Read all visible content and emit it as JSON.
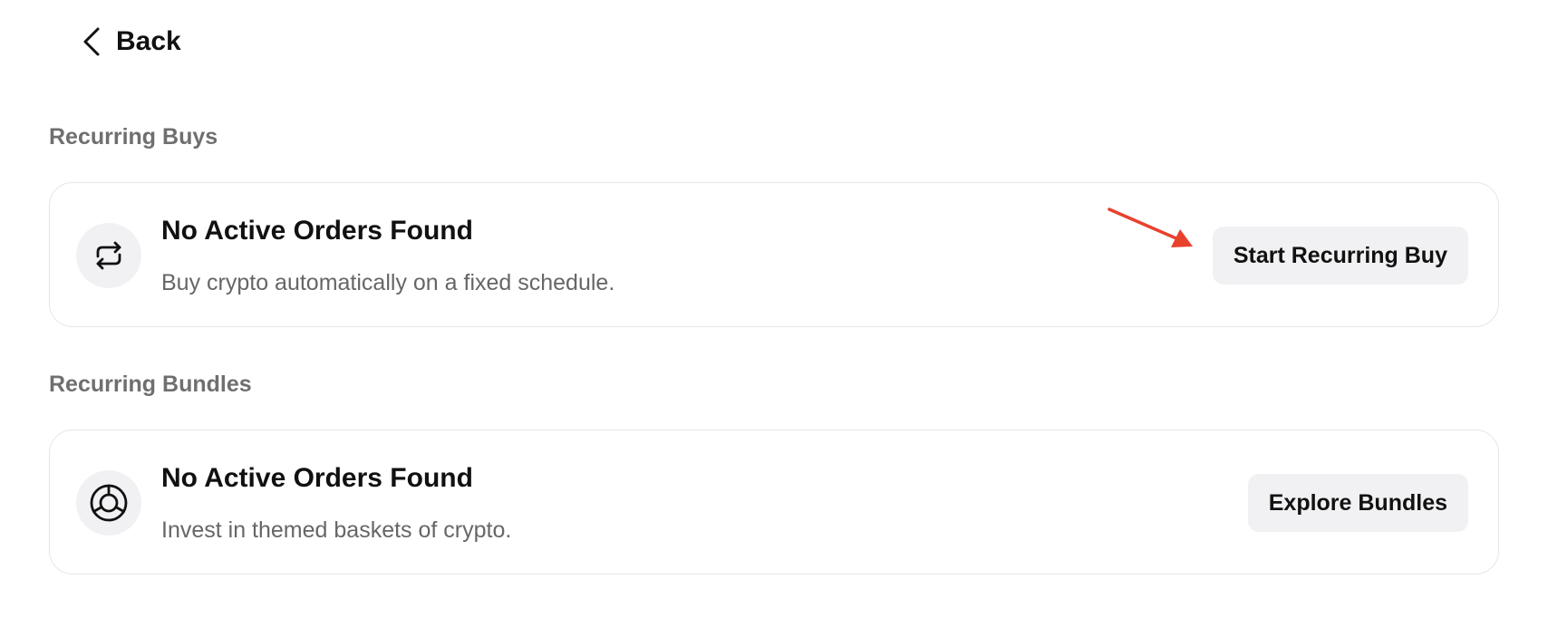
{
  "nav": {
    "back_label": "Back"
  },
  "sections": [
    {
      "title": "Recurring Buys",
      "card": {
        "icon": "recurring-arrows-icon",
        "title": "No Active Orders Found",
        "description": "Buy crypto automatically on a fixed schedule.",
        "button_label": "Start Recurring Buy"
      }
    },
    {
      "title": "Recurring Bundles",
      "card": {
        "icon": "bundle-circle-icon",
        "title": "No Active Orders Found",
        "description": "Invest in themed baskets of crypto.",
        "button_label": "Explore Bundles"
      }
    }
  ],
  "annotation": {
    "icon": "red-arrow-icon",
    "color": "#e8412c"
  },
  "colors": {
    "text_primary": "#111111",
    "text_secondary": "#666666",
    "section_title": "#6f6f6f",
    "button_bg": "#f1f1f3",
    "card_border": "#e6e6e6"
  }
}
